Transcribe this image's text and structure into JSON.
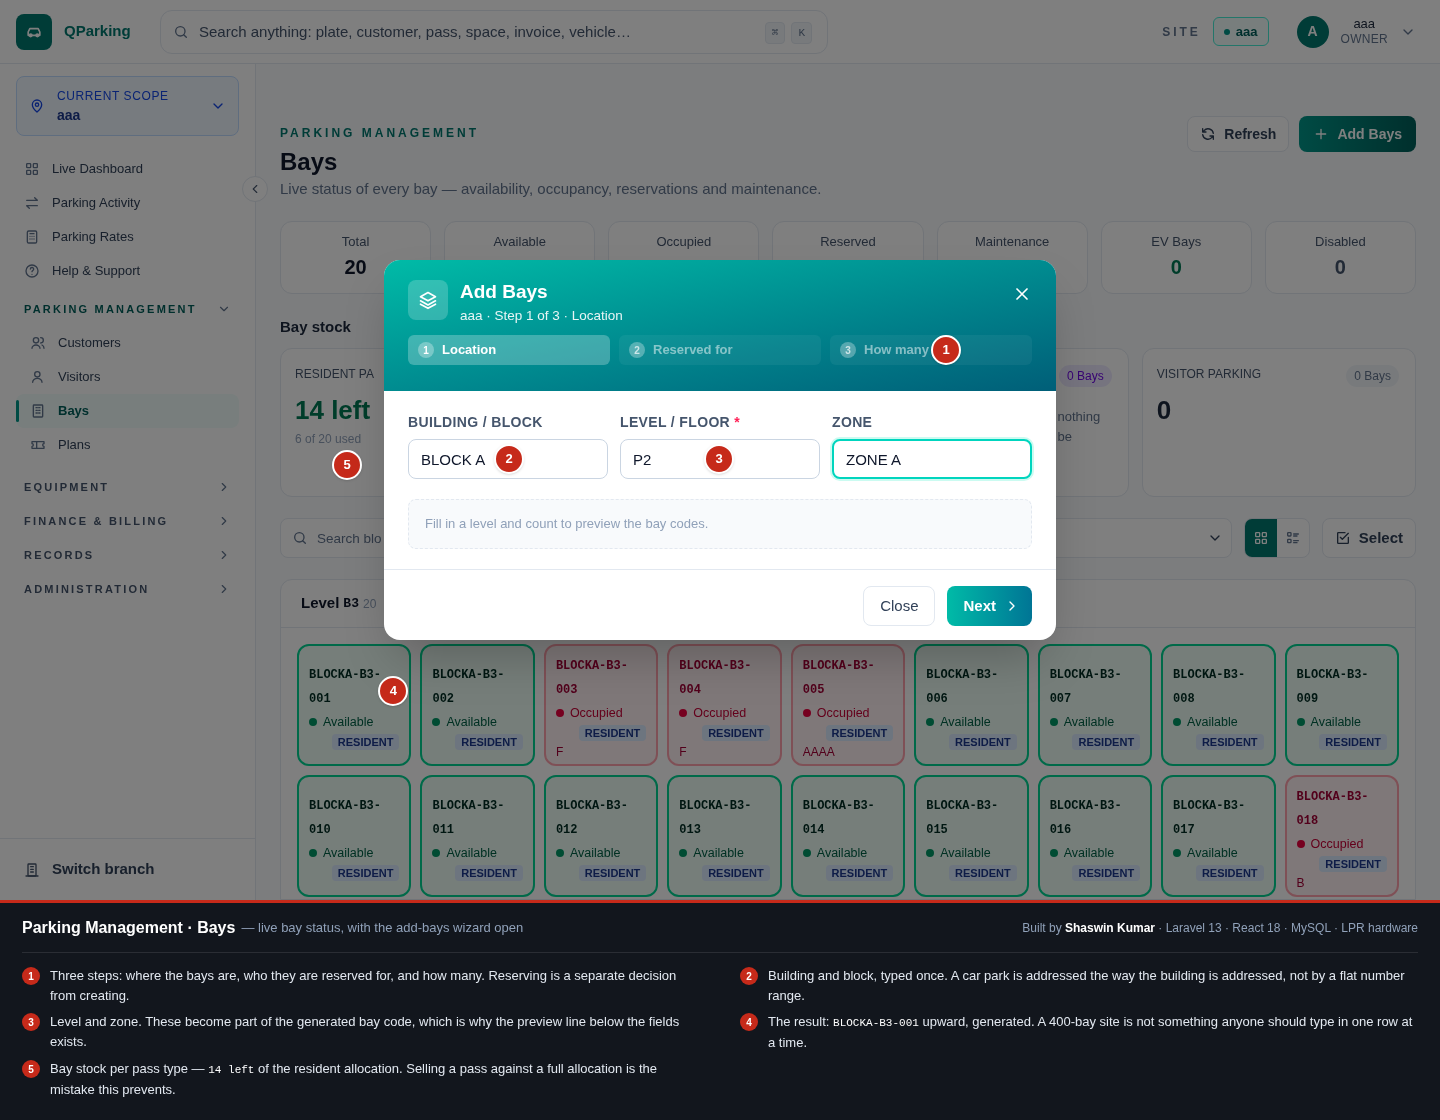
{
  "topbar": {
    "brand": "QParking",
    "search": {
      "placeholder": "Search anything: plate, customer, pass, space, invoice, vehicle…",
      "keys": [
        "⌘",
        "K"
      ]
    },
    "site_label": "SITE",
    "site": "aaa",
    "user": {
      "initial": "A",
      "name": "aaa",
      "role": "OWNER"
    }
  },
  "sidebar": {
    "scope": {
      "label": "CURRENT SCOPE",
      "value": "aaa"
    },
    "items": [
      {
        "label": "Live Dashboard",
        "selected": false
      },
      {
        "label": "Parking Activity",
        "selected": false
      },
      {
        "label": "Parking Rates",
        "selected": false
      },
      {
        "label": "Help & Support",
        "selected": false
      }
    ],
    "sections": [
      {
        "title": "PARKING MANAGEMENT",
        "expanded": true,
        "items": [
          {
            "label": "Customers",
            "selected": false
          },
          {
            "label": "Visitors",
            "selected": false
          },
          {
            "label": "Bays",
            "selected": true
          },
          {
            "label": "Plans",
            "selected": false
          }
        ]
      },
      {
        "title": "EQUIPMENT",
        "expanded": false
      },
      {
        "title": "FINANCE & BILLING",
        "expanded": false
      },
      {
        "title": "RECORDS",
        "expanded": false
      },
      {
        "title": "ADMINISTRATION",
        "expanded": false
      }
    ],
    "footer": "Switch branch"
  },
  "header": {
    "eyebrow": "PARKING MANAGEMENT",
    "title": "Bays",
    "subtitle": "Live status of every bay — availability, occupancy, reservations and maintenance.",
    "actions": [
      "Refresh",
      "Add Bays"
    ]
  },
  "stats": [
    {
      "label": "Total",
      "value": "20"
    },
    {
      "label": "Available"
    },
    {
      "label": "Occupied"
    },
    {
      "label": "Reserved"
    },
    {
      "label": "Maintenance"
    },
    {
      "label": "EV Bays",
      "value": "0"
    },
    {
      "label": "Disabled",
      "value": "0"
    }
  ],
  "stock": {
    "title": "Bay stock",
    "cards": [
      {
        "title": "RESIDENT PA",
        "value": "14 left",
        "caption": "6 of 20 used",
        "marker": "5"
      },
      {
        "badge": "0 Bays",
        "note": [
          "nothing",
          "be"
        ]
      },
      {
        "title": "VISITOR PARKING",
        "badge": "0 Bays",
        "value": "0"
      }
    ]
  },
  "toolbar": {
    "search": {
      "placeholder": "Search blo"
    },
    "views": [
      {
        "selected": true
      },
      {
        "selected": false
      }
    ],
    "select_button": "Select"
  },
  "level": {
    "title": "Level",
    "code": "B3",
    "count": "20"
  },
  "bays": [
    {
      "code": "BLOCKA-B3-001",
      "kind": "available",
      "status": "Available",
      "tag": "RESIDENT",
      "marker": "4"
    },
    {
      "code": "BLOCKA-B3-002",
      "kind": "available",
      "status": "Available",
      "tag": "RESIDENT"
    },
    {
      "code": "BLOCKA-B3-003",
      "kind": "occupied",
      "status": "Occupied",
      "tag": "RESIDENT",
      "note": "F"
    },
    {
      "code": "BLOCKA-B3-004",
      "kind": "occupied",
      "status": "Occupied",
      "tag": "RESIDENT",
      "note": "F"
    },
    {
      "code": "BLOCKA-B3-005",
      "kind": "occupied",
      "status": "Occupied",
      "tag": "RESIDENT",
      "note": "AAAA"
    },
    {
      "code": "BLOCKA-B3-006",
      "kind": "available",
      "status": "Available",
      "tag": "RESIDENT"
    },
    {
      "code": "BLOCKA-B3-007",
      "kind": "available",
      "status": "Available",
      "tag": "RESIDENT"
    },
    {
      "code": "BLOCKA-B3-008",
      "kind": "available",
      "status": "Available",
      "tag": "RESIDENT"
    },
    {
      "code": "BLOCKA-B3-009",
      "kind": "available",
      "status": "Available",
      "tag": "RESIDENT"
    },
    {
      "code": "BLOCKA-B3-010",
      "kind": "available",
      "status": "Available",
      "tag": "RESIDENT"
    },
    {
      "code": "BLOCKA-B3-011",
      "kind": "available",
      "status": "Available",
      "tag": "RESIDENT"
    },
    {
      "code": "BLOCKA-B3-012",
      "kind": "available",
      "status": "Available",
      "tag": "RESIDENT"
    },
    {
      "code": "BLOCKA-B3-013",
      "kind": "available",
      "status": "Available",
      "tag": "RESIDENT"
    },
    {
      "code": "BLOCKA-B3-014",
      "kind": "available",
      "status": "Available",
      "tag": "RESIDENT"
    },
    {
      "code": "BLOCKA-B3-015",
      "kind": "available",
      "status": "Available",
      "tag": "RESIDENT"
    },
    {
      "code": "BLOCKA-B3-016",
      "kind": "available",
      "status": "Available",
      "tag": "RESIDENT"
    },
    {
      "code": "BLOCKA-B3-017",
      "kind": "available",
      "status": "Available",
      "tag": "RESIDENT"
    },
    {
      "code": "BLOCKA-B3-018",
      "kind": "occupied",
      "status": "Occupied",
      "tag": "RESIDENT",
      "note": "B"
    }
  ],
  "modal": {
    "title": "Add Bays",
    "subtitle": "aaa · Step 1 of 3 · Location",
    "steps": [
      {
        "number": "1",
        "label": "Location",
        "selected": true
      },
      {
        "number": "2",
        "label": "Reserved for",
        "selected": false
      },
      {
        "number": "3",
        "label": "How many",
        "selected": false,
        "marker": "1"
      }
    ],
    "fields": [
      {
        "label": "BUILDING / BLOCK",
        "value": "BLOCK A",
        "marker": "2",
        "focused": false
      },
      {
        "label": "LEVEL / FLOOR",
        "required_mark": "*",
        "value": "P2",
        "marker": "3",
        "focused": false
      },
      {
        "label": "ZONE",
        "value": "ZONE A",
        "focused": true
      }
    ],
    "preview": "Fill in a level and count to preview the bay codes.",
    "buttons": {
      "close": "Close",
      "next": "Next"
    }
  },
  "footer": {
    "title": "Parking Management · Bays",
    "subtitle": "— live bay status, with the add-bays wizard open",
    "credit": "Built by **Shaswin Kumar** · Laravel 13 · React 18 · MySQL · LPR hardware",
    "notes": [
      {
        "number": "1",
        "parts": [
          {
            "kind": "text",
            "text": "Three steps: where the bays are, who they are reserved for, and how many. Reserving is a separate decision from creating."
          }
        ]
      },
      {
        "number": "2",
        "parts": [
          {
            "kind": "text",
            "text": "Building and block, typed once. A car park is addressed the way the building is addressed, not by a flat number range."
          }
        ]
      },
      {
        "number": "3",
        "parts": [
          {
            "kind": "text",
            "text": "Level and zone. These become part of the generated bay code, which is why the preview line below the fields exists."
          }
        ]
      },
      {
        "number": "4",
        "parts": [
          {
            "kind": "text",
            "text": "The result: "
          },
          {
            "kind": "code",
            "text": "BLOCKA-B3-001"
          },
          {
            "kind": "text",
            "text": " upward, generated. A 400-bay site is not something anyone should type in one row at a time."
          }
        ]
      },
      {
        "number": "5",
        "parts": [
          {
            "kind": "text",
            "text": "Bay stock per pass type — "
          },
          {
            "kind": "code",
            "text": "14 left"
          },
          {
            "kind": "text",
            "text": " of the resident allocation. Selling a pass against a full allocation is the mistake this prevents."
          }
        ]
      }
    ]
  }
}
